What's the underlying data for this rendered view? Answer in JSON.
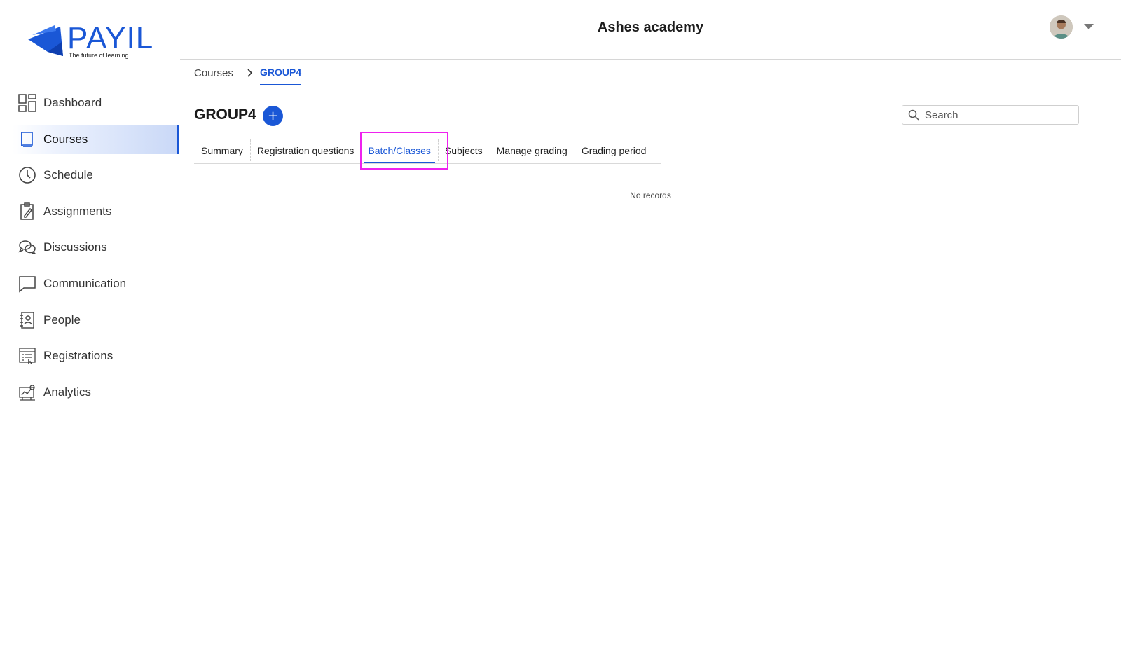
{
  "brand": {
    "name": "PAYIL",
    "tagline": "The future of learning",
    "color": "#1a57d6"
  },
  "sidebar": {
    "items": [
      {
        "label": "Dashboard",
        "icon": "dashboard-icon",
        "active": false
      },
      {
        "label": "Courses",
        "icon": "book-icon",
        "active": true
      },
      {
        "label": "Schedule",
        "icon": "clock-icon",
        "active": false
      },
      {
        "label": "Assignments",
        "icon": "clipboard-icon",
        "active": false
      },
      {
        "label": "Discussions",
        "icon": "chat-bubbles-icon",
        "active": false
      },
      {
        "label": "Communication",
        "icon": "message-icon",
        "active": false
      },
      {
        "label": "People",
        "icon": "contact-book-icon",
        "active": false
      },
      {
        "label": "Registrations",
        "icon": "registration-form-icon",
        "active": false
      },
      {
        "label": "Analytics",
        "icon": "analytics-icon",
        "active": false
      }
    ]
  },
  "header": {
    "title": "Ashes academy",
    "avatar_icon": "user-avatar",
    "menu_icon": "caret-down-icon"
  },
  "breadcrumb": {
    "parent": "Courses",
    "separator_icon": "chevron-right-icon",
    "current": "GROUP4"
  },
  "main": {
    "title": "GROUP4",
    "add_label": "+",
    "search": {
      "placeholder": "Search",
      "value": ""
    },
    "tabs": [
      {
        "label": "Summary",
        "active": false
      },
      {
        "label": "Registration questions",
        "active": false
      },
      {
        "label": "Batch/Classes",
        "active": true
      },
      {
        "label": "Subjects",
        "active": false
      },
      {
        "label": "Manage grading",
        "active": false
      },
      {
        "label": "Grading period",
        "active": false
      }
    ],
    "empty_text": "No records"
  },
  "colors": {
    "accent": "#1a57d6",
    "highlight": "#ee22ee"
  }
}
